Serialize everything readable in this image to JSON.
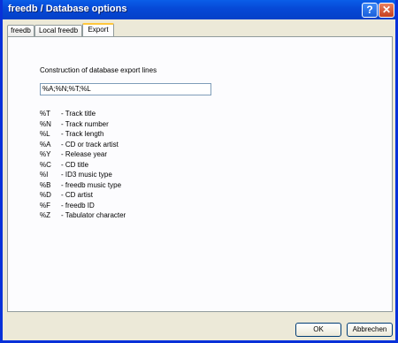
{
  "window": {
    "title": "freedb / Database options",
    "help_glyph": "?",
    "close_glyph": "✕"
  },
  "tabs": [
    {
      "label": "freedb"
    },
    {
      "label": "Local freedb"
    },
    {
      "label": "Export"
    }
  ],
  "export": {
    "label": "Construction of database export lines",
    "value": "%A;%N;%T;%L",
    "legend": [
      {
        "code": "%T",
        "desc": "- Track title"
      },
      {
        "code": "%N",
        "desc": "- Track number"
      },
      {
        "code": "%L",
        "desc": "- Track length"
      },
      {
        "code": "%A",
        "desc": "- CD or track artist"
      },
      {
        "code": "%Y",
        "desc": "- Release year"
      },
      {
        "code": "%C",
        "desc": "- CD title"
      },
      {
        "code": "%I",
        "desc": "- ID3 music type"
      },
      {
        "code": "%B",
        "desc": "- freedb music type"
      },
      {
        "code": "%D",
        "desc": "- CD artist"
      },
      {
        "code": "%F",
        "desc": "- freedb ID"
      },
      {
        "code": "%Z",
        "desc": "- Tabulator character"
      }
    ]
  },
  "buttons": {
    "ok": "OK",
    "cancel": "Abbrechen"
  }
}
